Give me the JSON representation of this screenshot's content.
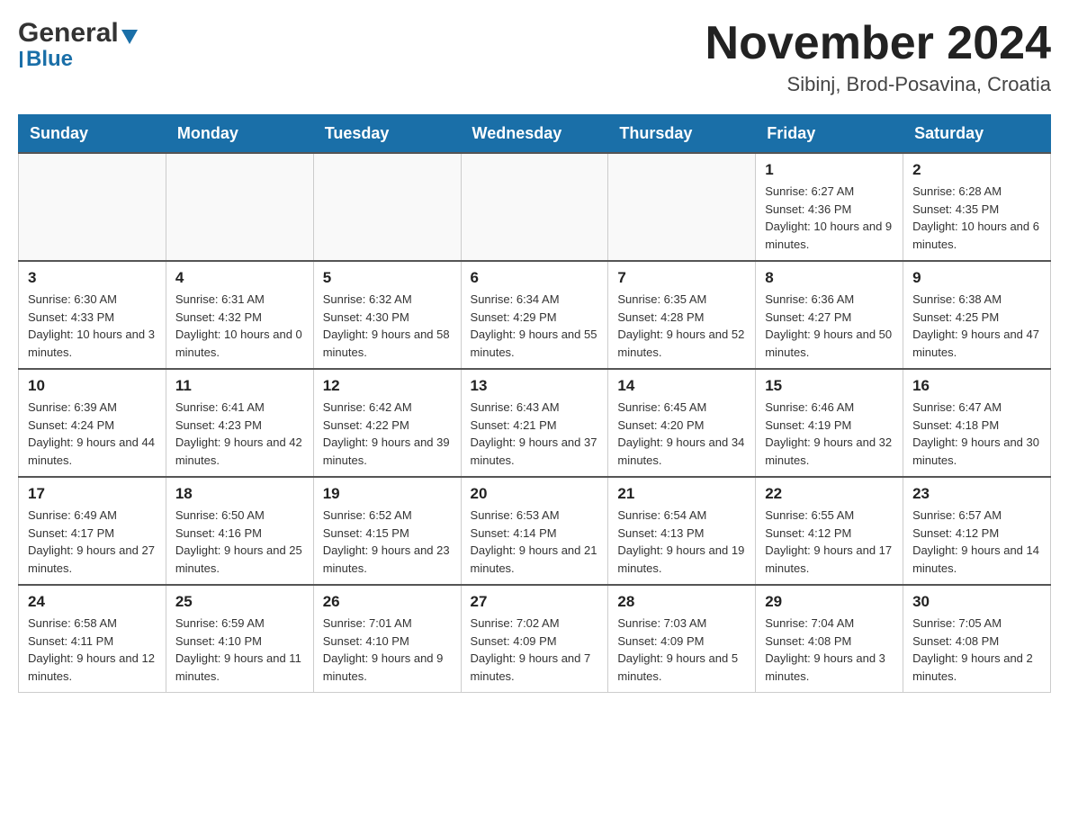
{
  "header": {
    "logo_general": "General",
    "logo_blue": "Blue",
    "month_title": "November 2024",
    "location": "Sibinj, Brod-Posavina, Croatia"
  },
  "weekdays": [
    "Sunday",
    "Monday",
    "Tuesday",
    "Wednesday",
    "Thursday",
    "Friday",
    "Saturday"
  ],
  "weeks": [
    {
      "days": [
        {
          "num": "",
          "info": ""
        },
        {
          "num": "",
          "info": ""
        },
        {
          "num": "",
          "info": ""
        },
        {
          "num": "",
          "info": ""
        },
        {
          "num": "",
          "info": ""
        },
        {
          "num": "1",
          "info": "Sunrise: 6:27 AM\nSunset: 4:36 PM\nDaylight: 10 hours and 9 minutes."
        },
        {
          "num": "2",
          "info": "Sunrise: 6:28 AM\nSunset: 4:35 PM\nDaylight: 10 hours and 6 minutes."
        }
      ]
    },
    {
      "days": [
        {
          "num": "3",
          "info": "Sunrise: 6:30 AM\nSunset: 4:33 PM\nDaylight: 10 hours and 3 minutes."
        },
        {
          "num": "4",
          "info": "Sunrise: 6:31 AM\nSunset: 4:32 PM\nDaylight: 10 hours and 0 minutes."
        },
        {
          "num": "5",
          "info": "Sunrise: 6:32 AM\nSunset: 4:30 PM\nDaylight: 9 hours and 58 minutes."
        },
        {
          "num": "6",
          "info": "Sunrise: 6:34 AM\nSunset: 4:29 PM\nDaylight: 9 hours and 55 minutes."
        },
        {
          "num": "7",
          "info": "Sunrise: 6:35 AM\nSunset: 4:28 PM\nDaylight: 9 hours and 52 minutes."
        },
        {
          "num": "8",
          "info": "Sunrise: 6:36 AM\nSunset: 4:27 PM\nDaylight: 9 hours and 50 minutes."
        },
        {
          "num": "9",
          "info": "Sunrise: 6:38 AM\nSunset: 4:25 PM\nDaylight: 9 hours and 47 minutes."
        }
      ]
    },
    {
      "days": [
        {
          "num": "10",
          "info": "Sunrise: 6:39 AM\nSunset: 4:24 PM\nDaylight: 9 hours and 44 minutes."
        },
        {
          "num": "11",
          "info": "Sunrise: 6:41 AM\nSunset: 4:23 PM\nDaylight: 9 hours and 42 minutes."
        },
        {
          "num": "12",
          "info": "Sunrise: 6:42 AM\nSunset: 4:22 PM\nDaylight: 9 hours and 39 minutes."
        },
        {
          "num": "13",
          "info": "Sunrise: 6:43 AM\nSunset: 4:21 PM\nDaylight: 9 hours and 37 minutes."
        },
        {
          "num": "14",
          "info": "Sunrise: 6:45 AM\nSunset: 4:20 PM\nDaylight: 9 hours and 34 minutes."
        },
        {
          "num": "15",
          "info": "Sunrise: 6:46 AM\nSunset: 4:19 PM\nDaylight: 9 hours and 32 minutes."
        },
        {
          "num": "16",
          "info": "Sunrise: 6:47 AM\nSunset: 4:18 PM\nDaylight: 9 hours and 30 minutes."
        }
      ]
    },
    {
      "days": [
        {
          "num": "17",
          "info": "Sunrise: 6:49 AM\nSunset: 4:17 PM\nDaylight: 9 hours and 27 minutes."
        },
        {
          "num": "18",
          "info": "Sunrise: 6:50 AM\nSunset: 4:16 PM\nDaylight: 9 hours and 25 minutes."
        },
        {
          "num": "19",
          "info": "Sunrise: 6:52 AM\nSunset: 4:15 PM\nDaylight: 9 hours and 23 minutes."
        },
        {
          "num": "20",
          "info": "Sunrise: 6:53 AM\nSunset: 4:14 PM\nDaylight: 9 hours and 21 minutes."
        },
        {
          "num": "21",
          "info": "Sunrise: 6:54 AM\nSunset: 4:13 PM\nDaylight: 9 hours and 19 minutes."
        },
        {
          "num": "22",
          "info": "Sunrise: 6:55 AM\nSunset: 4:12 PM\nDaylight: 9 hours and 17 minutes."
        },
        {
          "num": "23",
          "info": "Sunrise: 6:57 AM\nSunset: 4:12 PM\nDaylight: 9 hours and 14 minutes."
        }
      ]
    },
    {
      "days": [
        {
          "num": "24",
          "info": "Sunrise: 6:58 AM\nSunset: 4:11 PM\nDaylight: 9 hours and 12 minutes."
        },
        {
          "num": "25",
          "info": "Sunrise: 6:59 AM\nSunset: 4:10 PM\nDaylight: 9 hours and 11 minutes."
        },
        {
          "num": "26",
          "info": "Sunrise: 7:01 AM\nSunset: 4:10 PM\nDaylight: 9 hours and 9 minutes."
        },
        {
          "num": "27",
          "info": "Sunrise: 7:02 AM\nSunset: 4:09 PM\nDaylight: 9 hours and 7 minutes."
        },
        {
          "num": "28",
          "info": "Sunrise: 7:03 AM\nSunset: 4:09 PM\nDaylight: 9 hours and 5 minutes."
        },
        {
          "num": "29",
          "info": "Sunrise: 7:04 AM\nSunset: 4:08 PM\nDaylight: 9 hours and 3 minutes."
        },
        {
          "num": "30",
          "info": "Sunrise: 7:05 AM\nSunset: 4:08 PM\nDaylight: 9 hours and 2 minutes."
        }
      ]
    }
  ]
}
